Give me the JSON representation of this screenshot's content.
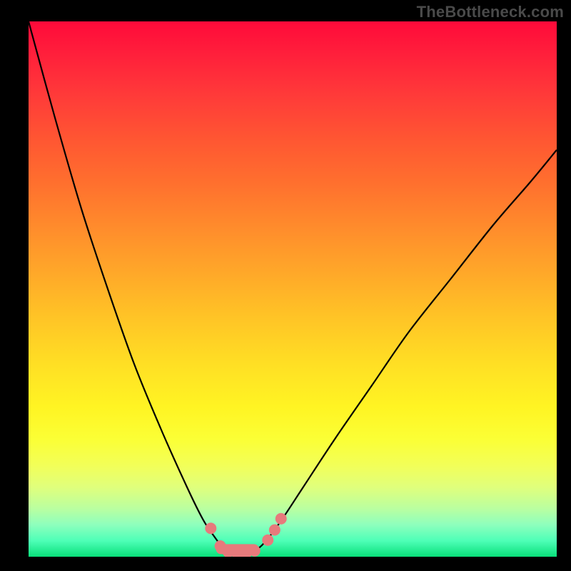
{
  "watermark": "TheBottleneck.com",
  "colors": {
    "background": "#000000",
    "curve_stroke": "#000000",
    "marker_fill": "#e77a7c",
    "gradient_top": "#ff0a3a",
    "gradient_bottom": "#09e07a"
  },
  "chart_data": {
    "type": "line",
    "title": "",
    "xlabel": "",
    "ylabel": "",
    "xlim": [
      0,
      100
    ],
    "ylim": [
      0,
      100
    ],
    "curve": {
      "description": "Bottleneck severity curve (0 = best / green band at bottom, 100 = worst / red at top). V-shaped: a steep quadratic descent from the left followed by a gentler near-linear rise to the right, with a flat minimum region around x≈37–44.",
      "x": [
        0,
        5,
        10,
        15,
        20,
        25,
        30,
        33,
        35,
        37,
        39,
        41,
        43,
        45,
        48,
        52,
        58,
        65,
        72,
        80,
        88,
        95,
        100
      ],
      "y": [
        100,
        82,
        65,
        50,
        36,
        24,
        13,
        7,
        4,
        1.5,
        0.5,
        0.5,
        1.2,
        3,
        7,
        13,
        22,
        32,
        42,
        52,
        62,
        70,
        76
      ]
    },
    "markers": {
      "description": "Highlighted sample points near the curve's minimum (rendered as salmon dots / short bar).",
      "points": [
        {
          "x": 34.5,
          "y": 5.3
        },
        {
          "x": 36.3,
          "y": 2.0
        },
        {
          "x": 37.8,
          "y": 0.9
        },
        {
          "x": 39.5,
          "y": 0.6
        },
        {
          "x": 41.2,
          "y": 0.7
        },
        {
          "x": 42.8,
          "y": 1.1
        },
        {
          "x": 45.3,
          "y": 3.1
        },
        {
          "x": 46.6,
          "y": 5.0
        },
        {
          "x": 47.8,
          "y": 7.1
        }
      ]
    }
  }
}
